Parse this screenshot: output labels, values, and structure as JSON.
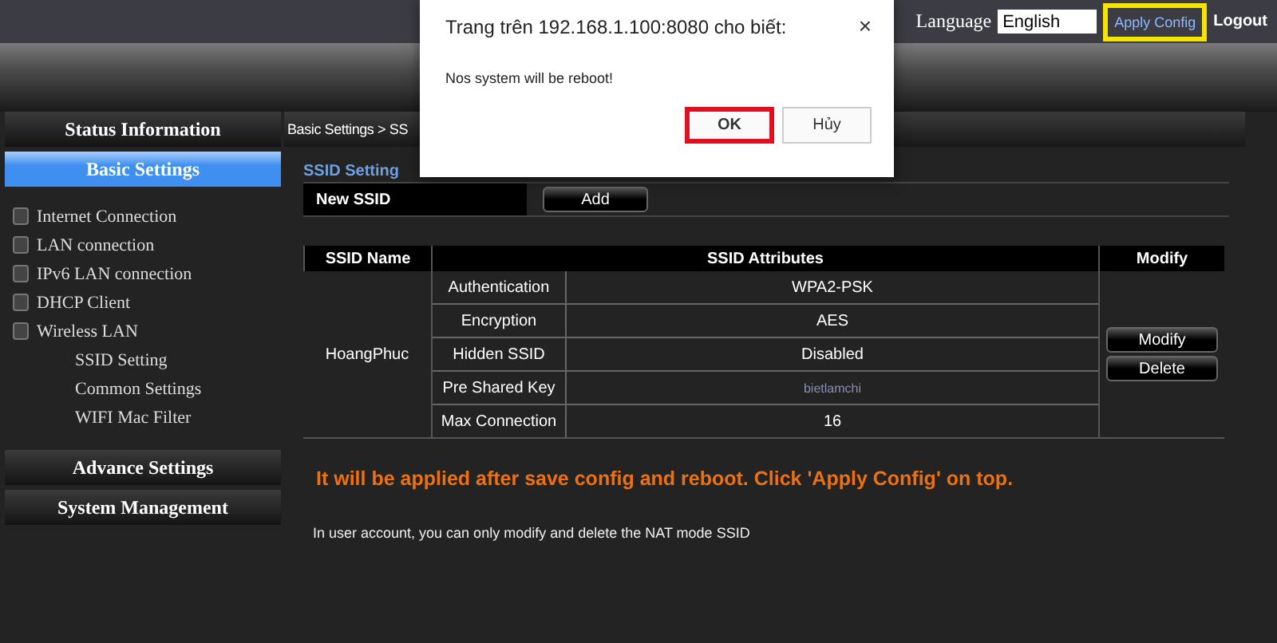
{
  "top_bar": {
    "language_label": "Language",
    "language_value": "English",
    "apply_config": {
      "label": "Apply Config",
      "highlighted": true
    },
    "logout": "Logout"
  },
  "sidebar": {
    "sections": [
      {
        "label": "Status Information",
        "selected": false
      },
      {
        "label": "Basic Settings",
        "selected": true,
        "items": [
          {
            "label": "Internet Connection"
          },
          {
            "label": "LAN connection"
          },
          {
            "label": "IPv6 LAN connection"
          },
          {
            "label": "DHCP Client"
          },
          {
            "label": "Wireless LAN",
            "children": [
              {
                "label": "SSID Setting"
              },
              {
                "label": "Common Settings"
              },
              {
                "label": "WIFI Mac Filter"
              }
            ]
          }
        ]
      },
      {
        "label": "Advance Settings",
        "selected": false
      },
      {
        "label": "System Management",
        "selected": false
      }
    ]
  },
  "breadcrumb": "Basic Settings > SS",
  "section_title": "SSID Setting",
  "new_ssid": {
    "label": "New SSID",
    "button": "Add"
  },
  "table": {
    "columns": [
      "SSID Name",
      "SSID Attributes",
      "Modify"
    ],
    "rows": [
      {
        "name": "HoangPhuc",
        "attributes": [
          {
            "label": "Authentication",
            "value": "WPA2-PSK"
          },
          {
            "label": "Encryption",
            "value": "AES"
          },
          {
            "label": "Hidden SSID",
            "value": "Disabled"
          },
          {
            "label": "Pre Shared Key",
            "value": "bietlamchi",
            "muted": true
          },
          {
            "label": "Max Connection",
            "value": "16"
          }
        ],
        "buttons": [
          "Modify",
          "Delete"
        ]
      }
    ]
  },
  "warning": "It will be applied after save config and reboot. Click 'Apply Config' on top.",
  "note": "In user account, you can only modify and delete the NAT mode SSID",
  "dialog": {
    "title": "Trang trên 192.168.1.100:8080 cho biết:",
    "close": "×",
    "message": "Nos system will be reboot!",
    "buttons": [
      {
        "label": "OK",
        "highlighted": true
      },
      {
        "label": "Hủy",
        "highlighted": false
      }
    ]
  }
}
